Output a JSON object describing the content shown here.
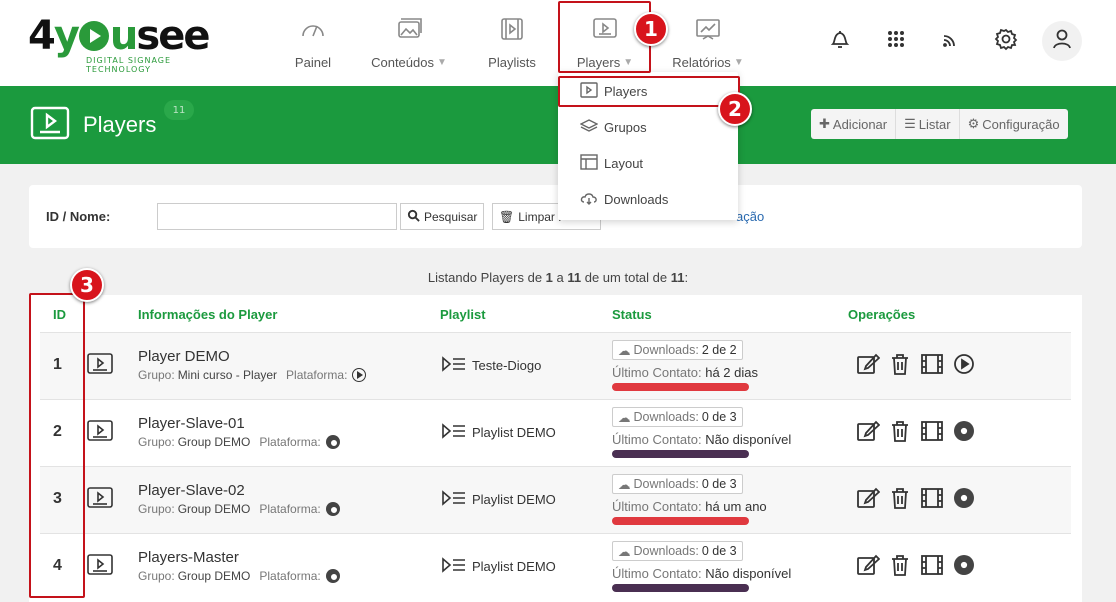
{
  "brand": {
    "logo_text_a": "4",
    "logo_text_b": "y",
    "logo_text_c": "u",
    "logo_text_d": "see",
    "tagline": "DIGITAL SIGNAGE TECHNOLOGY"
  },
  "nav": {
    "painel": "Painel",
    "conteudos": "Conteúdos",
    "playlists": "Playlists",
    "players": "Players",
    "relatorios": "Relatórios"
  },
  "header": {
    "title": "Players",
    "count": "11"
  },
  "actions": {
    "add": "Adicionar",
    "list": "Listar",
    "config": "Configuração"
  },
  "search": {
    "label": "ID / Nome:",
    "value": "",
    "search_btn": "Pesquisar",
    "clear_btn": "Limpar F",
    "link": "ação"
  },
  "listing_text": {
    "prefix": "Listando Players de ",
    "from": "1",
    "mid1": " a ",
    "to": "11",
    "mid2": " de um total de ",
    "total": "11",
    "suffix": ":"
  },
  "columns": {
    "id": "ID",
    "info": "Informações do Player",
    "playlist": "Playlist",
    "status": "Status",
    "ops": "Operações"
  },
  "rows": [
    {
      "id": "1",
      "name": "Player DEMO",
      "group_label": "Grupo:",
      "group": "Mini curso - Player",
      "platform_label": "Plataforma:",
      "platform": "play",
      "playlist": "Teste-Diogo",
      "dl_label": "Downloads:",
      "dl": "2 de 2",
      "contact_label": "Último Contato:",
      "contact": "há 2 dias",
      "bar_color": "#e0393f"
    },
    {
      "id": "2",
      "name": "Player-Slave-01",
      "group_label": "Grupo:",
      "group": "Group DEMO",
      "platform_label": "Plataforma:",
      "platform": "chrome",
      "playlist": "Playlist DEMO",
      "dl_label": "Downloads:",
      "dl": "0 de 3",
      "contact_label": "Último Contato:",
      "contact": "Não disponível",
      "bar_color": "#4a2f52"
    },
    {
      "id": "3",
      "name": "Player-Slave-02",
      "group_label": "Grupo:",
      "group": "Group DEMO",
      "platform_label": "Plataforma:",
      "platform": "chrome",
      "playlist": "Playlist DEMO",
      "dl_label": "Downloads:",
      "dl": "0 de 3",
      "contact_label": "Último Contato:",
      "contact": "há um ano",
      "bar_color": "#e0393f"
    },
    {
      "id": "4",
      "name": "Players-Master",
      "group_label": "Grupo:",
      "group": "Group DEMO",
      "platform_label": "Plataforma:",
      "platform": "chrome",
      "playlist": "Playlist DEMO",
      "dl_label": "Downloads:",
      "dl": "0 de 3",
      "contact_label": "Último Contato:",
      "contact": "Não disponível",
      "bar_color": "#4a2f52"
    }
  ],
  "dropdown": {
    "players": "Players",
    "grupos": "Grupos",
    "layout": "Layout",
    "downloads": "Downloads"
  },
  "markers": {
    "m1": "1",
    "m2": "2",
    "m3": "3"
  },
  "colors": {
    "brand_green": "#1b9a3e",
    "highlight_red": "#c4121a"
  }
}
